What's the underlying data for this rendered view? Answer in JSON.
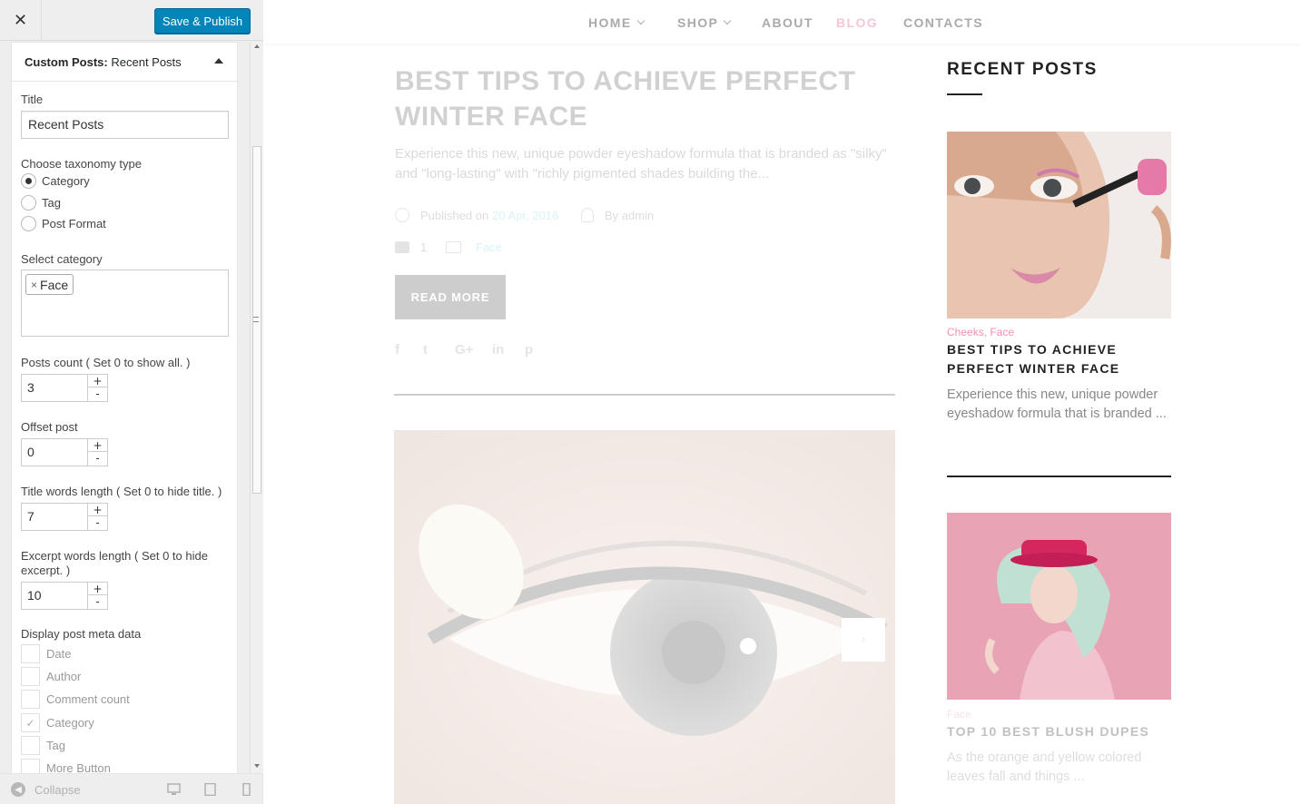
{
  "customizer": {
    "close_icon": "close-icon",
    "save_label": "Save & Publish",
    "widget": {
      "title_prefix": "Custom Posts:",
      "title_name": "Recent Posts",
      "title_label": "Title",
      "title_value": "Recent Posts",
      "taxonomy_label": "Choose taxonomy type",
      "taxonomy_options": [
        "Category",
        "Tag",
        "Post Format"
      ],
      "taxonomy_selected": "Category",
      "select_category_label": "Select category",
      "selected_category_remove": "×",
      "selected_category": "Face",
      "posts_count_label": "Posts count ( Set 0 to show all. )",
      "posts_count_value": "3",
      "offset_label": "Offset post",
      "offset_value": "0",
      "title_words_label": "Title words length ( Set 0 to hide title. )",
      "title_words_value": "7",
      "excerpt_words_label": "Excerpt words length ( Set 0 to hide excerpt. )",
      "excerpt_words_value": "10",
      "meta_label": "Display post meta data",
      "meta_options": [
        {
          "label": "Date",
          "checked": false
        },
        {
          "label": "Author",
          "checked": false
        },
        {
          "label": "Comment count",
          "checked": false
        },
        {
          "label": "Category",
          "checked": true
        },
        {
          "label": "Tag",
          "checked": false
        },
        {
          "label": "More Button",
          "checked": false
        }
      ],
      "spinner_plus": "+",
      "spinner_minus": "-",
      "check_mark": "✓"
    },
    "footer": {
      "collapse_label": "Collapse",
      "collapse_arrow": "◀"
    }
  },
  "preview": {
    "nav": {
      "home": "HOME",
      "shop": "SHOP",
      "about": "ABOUT",
      "blog": "BLOG",
      "contacts": "CONTACTS"
    },
    "post": {
      "title": "BEST TIPS TO ACHIEVE PERFECT WINTER FACE",
      "excerpt": "Experience this new, unique powder eyeshadow formula that is branded as \"silky\" and \"long-lasting\" with \"richly pigmented shades building the...",
      "published_prefix": "Published on",
      "published_date": "20 Apr, 2016",
      "author": "By admin",
      "comment_count": "1",
      "category": "Face",
      "read_more": "READ MORE",
      "share": [
        "f",
        "t",
        "G+",
        "in",
        "p"
      ],
      "slider_next": "›"
    },
    "sidebar": {
      "title": "RECENT POSTS",
      "posts": [
        {
          "cats": "Cheeks, Face",
          "title": "BEST TIPS TO ACHIEVE PERFECT WINTER FACE",
          "excerpt": "Experience this new, unique powder eyeshadow formula that is branded ..."
        },
        {
          "cats": "Face",
          "title": "TOP 10 BEST BLUSH DUPES",
          "excerpt": "As the orange and yellow colored leaves fall and things ..."
        }
      ]
    }
  },
  "colors": {
    "primary_button": "#0085ba",
    "accent_pink": "#f48fb1",
    "link_blue": "#55c2e0"
  }
}
